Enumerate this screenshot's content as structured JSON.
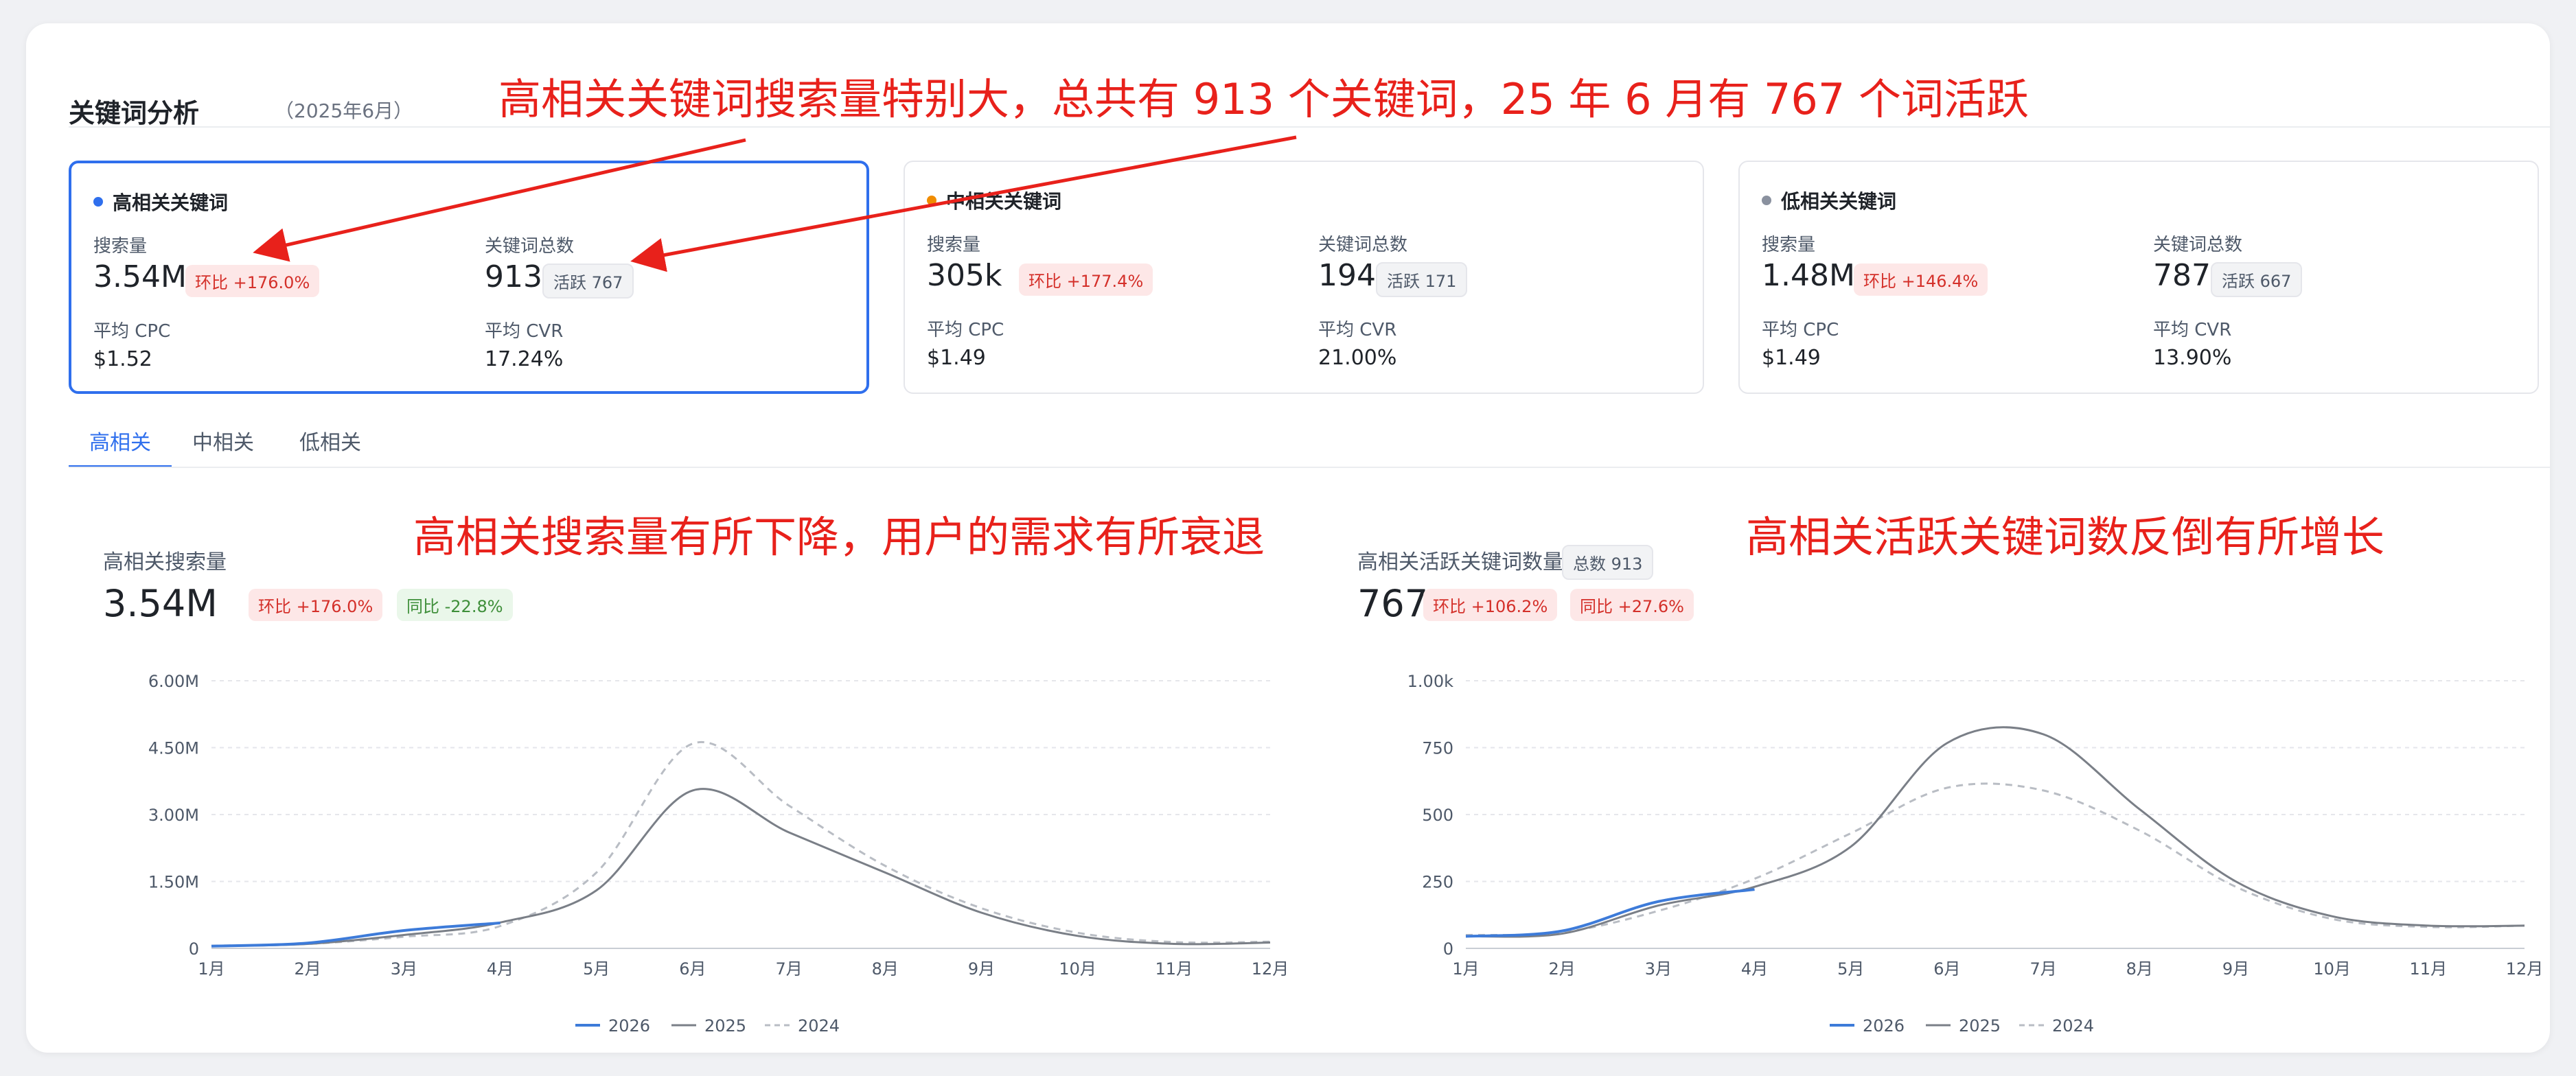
{
  "header": {
    "title": "关键词分析",
    "subtitle": "（2025年6月）"
  },
  "annotations": [
    "高相关关键词搜索量特别大，总共有 913 个关键词，25 年 6 月有 767 个词活跃",
    "高相关搜索量有所下降，用户的需求有所衰退",
    "高相关活跃关键词数反倒有所增长"
  ],
  "cards": [
    {
      "title": "高相关关键词",
      "dot_color": "#2f6fed",
      "search_label": "搜索量",
      "search_value": "3.54M",
      "mom": "环比 +176.0%",
      "total_label": "关键词总数",
      "total_value": "913",
      "active": "活跃 767",
      "cpc_label": "平均 CPC",
      "cpc_value": "$1.52",
      "cvr_label": "平均 CVR",
      "cvr_value": "17.24%"
    },
    {
      "title": "中相关关键词",
      "dot_color": "#f08c00",
      "search_label": "搜索量",
      "search_value": "305k",
      "mom": "环比 +177.4%",
      "total_label": "关键词总数",
      "total_value": "194",
      "active": "活跃 171",
      "cpc_label": "平均 CPC",
      "cpc_value": "$1.49",
      "cvr_label": "平均 CVR",
      "cvr_value": "21.00%"
    },
    {
      "title": "低相关关键词",
      "dot_color": "#8a919f",
      "search_label": "搜索量",
      "search_value": "1.48M",
      "mom": "环比 +146.4%",
      "total_label": "关键词总数",
      "total_value": "787",
      "active": "活跃 667",
      "cpc_label": "平均 CPC",
      "cpc_value": "$1.49",
      "cvr_label": "平均 CVR",
      "cvr_value": "13.90%"
    }
  ],
  "tabs": [
    "高相关",
    "中相关",
    "低相关"
  ],
  "left_chart": {
    "title": "高相关搜索量",
    "value": "3.54M",
    "mom": "环比 +176.0%",
    "yoy": "同比 -22.8%"
  },
  "right_chart": {
    "title": "高相关活跃关键词数量",
    "total": "总数 913",
    "value": "767",
    "mom": "环比 +106.2%",
    "yoy": "同比 +27.6%"
  },
  "colors": {
    "accent": "#2f6fed",
    "s2026": "#3d7bd9",
    "s2025": "#7a7f87",
    "s2024": "#b9bdc4",
    "annotation": "#e8211b"
  },
  "chart_data": [
    {
      "type": "line",
      "x": [
        "1月",
        "2月",
        "3月",
        "4月",
        "5月",
        "6月",
        "7月",
        "8月",
        "9月",
        "10月",
        "11月",
        "12月"
      ],
      "yticks": [
        "0",
        "1.50M",
        "3.00M",
        "4.50M",
        "6.00M"
      ],
      "ylim": [
        0,
        6000000
      ],
      "grid": true,
      "legend": "bottom",
      "series": [
        {
          "name": "2026",
          "values": [
            50000,
            120000,
            400000,
            570000,
            null,
            null,
            null,
            null,
            null,
            null,
            null,
            null
          ]
        },
        {
          "name": "2025",
          "values": [
            50000,
            100000,
            300000,
            580000,
            1300000,
            3540000,
            2600000,
            1700000,
            800000,
            280000,
            100000,
            130000
          ]
        },
        {
          "name": "2024",
          "values": [
            60000,
            100000,
            260000,
            500000,
            1700000,
            4590000,
            3200000,
            1850000,
            900000,
            350000,
            140000,
            150000
          ]
        }
      ]
    },
    {
      "type": "line",
      "x": [
        "1月",
        "2月",
        "3月",
        "4月",
        "5月",
        "6月",
        "7月",
        "8月",
        "9月",
        "10月",
        "11月",
        "12月"
      ],
      "yticks": [
        "0",
        "250",
        "500",
        "750",
        "1.00k"
      ],
      "ylim": [
        0,
        1000
      ],
      "grid": true,
      "legend": "bottom",
      "series": [
        {
          "name": "2026",
          "values": [
            45,
            65,
            175,
            220,
            null,
            null,
            null,
            null,
            null,
            null,
            null,
            null
          ]
        },
        {
          "name": "2025",
          "values": [
            45,
            55,
            160,
            230,
            380,
            767,
            800,
            520,
            250,
            120,
            85,
            85
          ]
        },
        {
          "name": "2024",
          "values": [
            50,
            60,
            140,
            260,
            430,
            600,
            590,
            440,
            230,
            110,
            80,
            85
          ]
        }
      ]
    }
  ]
}
